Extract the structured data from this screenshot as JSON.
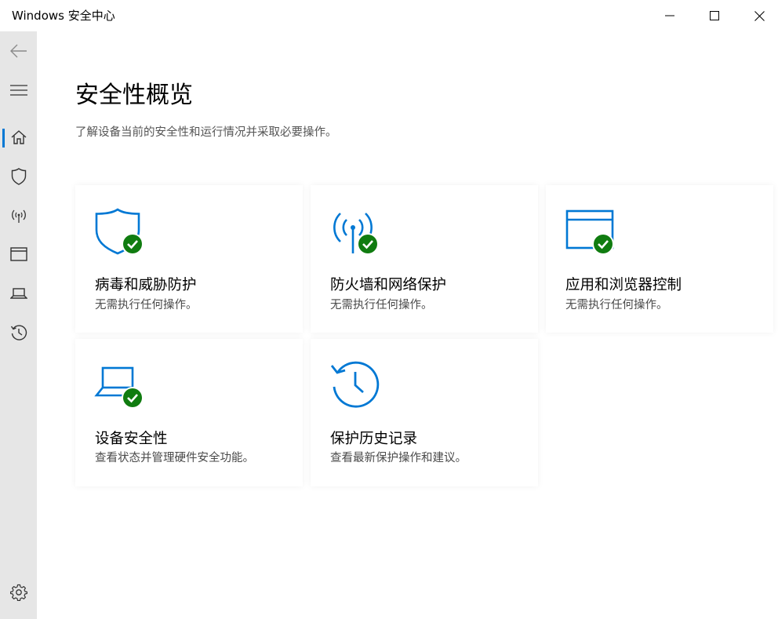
{
  "window": {
    "title": "Windows 安全中心"
  },
  "nav": {
    "items": [
      {
        "name": "back",
        "icon": "back-arrow-icon"
      },
      {
        "name": "menu",
        "icon": "hamburger-icon"
      },
      {
        "name": "home",
        "icon": "home-icon",
        "active": true
      },
      {
        "name": "virus-protection",
        "icon": "shield-icon"
      },
      {
        "name": "firewall",
        "icon": "antenna-icon"
      },
      {
        "name": "app-browser",
        "icon": "browser-window-icon"
      },
      {
        "name": "device-security",
        "icon": "laptop-icon"
      },
      {
        "name": "history",
        "icon": "history-icon"
      },
      {
        "name": "settings",
        "icon": "gear-icon"
      }
    ]
  },
  "page": {
    "title": "安全性概览",
    "subtitle": "了解设备当前的安全性和运行情况并采取必要操作。"
  },
  "tiles": [
    {
      "title": "病毒和威胁防护",
      "desc": "无需执行任何操作。",
      "icon": "shield-check-icon",
      "status": "ok"
    },
    {
      "title": "防火墙和网络保护",
      "desc": "无需执行任何操作。",
      "icon": "antenna-check-icon",
      "status": "ok"
    },
    {
      "title": "应用和浏览器控制",
      "desc": "无需执行任何操作。",
      "icon": "browser-check-icon",
      "status": "ok"
    },
    {
      "title": "设备安全性",
      "desc": "查看状态并管理硬件安全功能。",
      "icon": "laptop-check-icon",
      "status": "ok"
    },
    {
      "title": "保护历史记录",
      "desc": "查看最新保护操作和建议。",
      "icon": "history-icon"
    }
  ],
  "colors": {
    "accent": "#0078d4",
    "ok": "#107c10",
    "sidebar": "#e6e6e6"
  }
}
